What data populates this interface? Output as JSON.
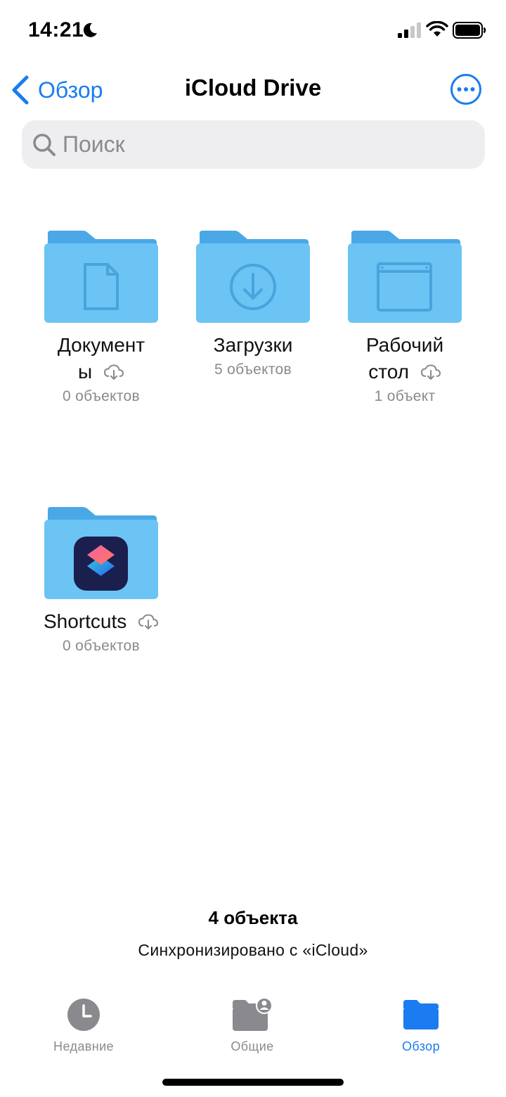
{
  "status_bar": {
    "time": "14:21"
  },
  "nav": {
    "back_label": "Обзор",
    "title": "iCloud Drive"
  },
  "search": {
    "placeholder": "Поиск"
  },
  "folders": [
    {
      "name_line1": "Документ",
      "name_line2": "ы",
      "count": "0 объектов",
      "icon": "document-icon",
      "cloud": true
    },
    {
      "name_line1": "Загрузки",
      "count": "5 объектов",
      "icon": "download-icon",
      "cloud": false
    },
    {
      "name_line1": "Рабочий",
      "name_line2": "стол",
      "count": "1 объект",
      "icon": "window-icon",
      "cloud": true
    },
    {
      "name_line1": "Shortcuts",
      "count": "0 объектов",
      "icon": "shortcuts-app-icon",
      "cloud": true
    }
  ],
  "footer": {
    "summary": "4 объекта",
    "sync_status": "Синхронизировано с «iCloud»"
  },
  "tabs": [
    {
      "label": "Недавние",
      "icon": "clock-icon",
      "active": false
    },
    {
      "label": "Общие",
      "icon": "shared-folder-icon",
      "active": false
    },
    {
      "label": "Обзор",
      "icon": "folder-icon",
      "active": true
    }
  ],
  "colors": {
    "accent": "#1a7cf0",
    "folder_back": "#4aa8e6",
    "folder_front": "#6cc4f4",
    "secondary_text": "#8a8a8e",
    "search_bg": "#eeeef0"
  }
}
